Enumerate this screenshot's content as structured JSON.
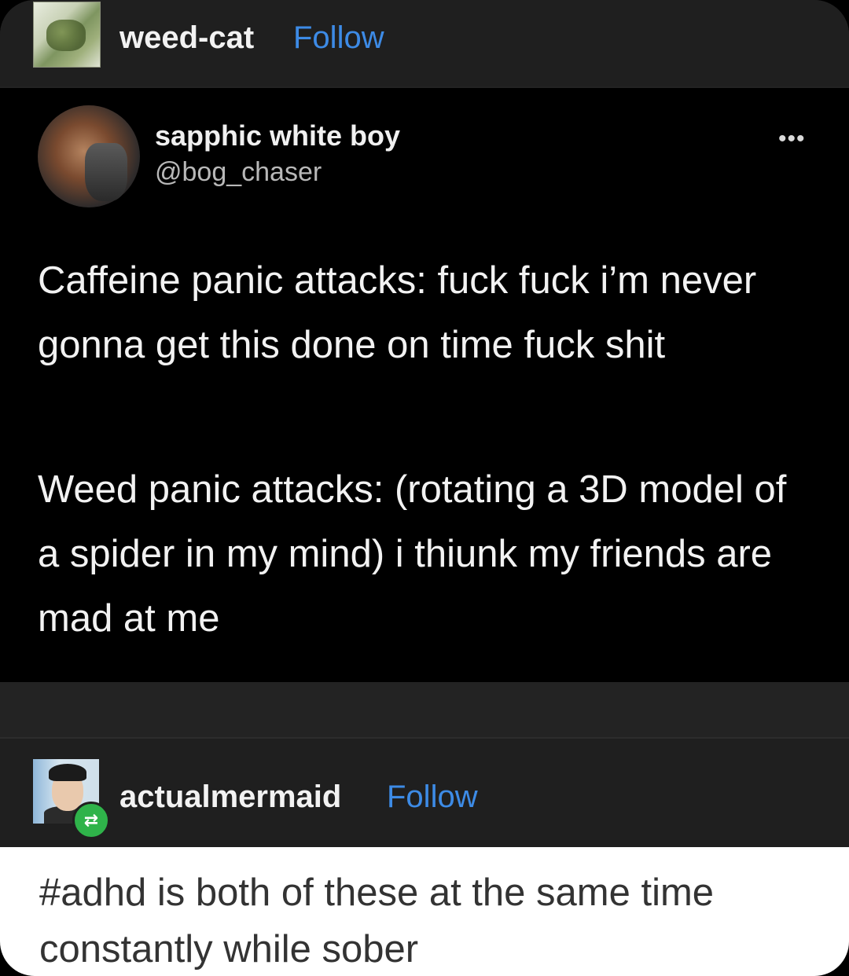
{
  "header1": {
    "username": "weed-cat",
    "follow_label": "Follow"
  },
  "tweet": {
    "display_name": "sapphic white boy",
    "handle": "@bog_chaser",
    "more_label": "•••",
    "paragraphs": [
      "Caffeine panic attacks: fuck fuck i’m never gonna get this done on time fuck shit",
      "Weed panic attacks: (rotating a 3D model of a spider in my mind) i thiunk my friends are mad at me"
    ]
  },
  "header2": {
    "username": "actualmermaid",
    "follow_label": "Follow"
  },
  "comment": {
    "text": "#adhd is both of these at the same time constantly while sober"
  },
  "colors": {
    "follow": "#3d8be6",
    "reblog_badge": "#2fb34a"
  },
  "icons": {
    "reblog": "reblog-icon",
    "more": "more-icon"
  }
}
